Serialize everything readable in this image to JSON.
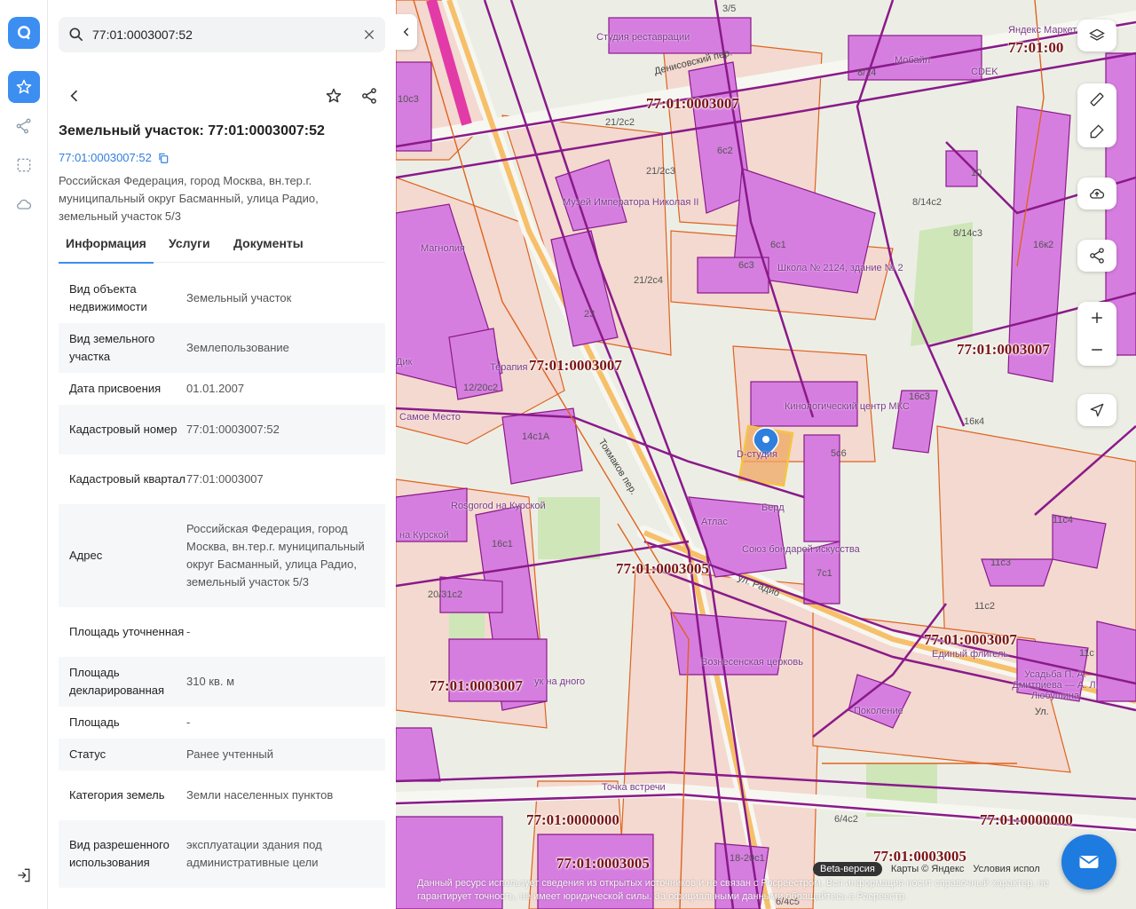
{
  "search": {
    "value": "77:01:0003007:52"
  },
  "object": {
    "title": "Земельный участок: 77:01:0003007:52",
    "cadastral_link": "77:01:0003007:52",
    "address": "Российская Федерация, город Москва, вн.тер.г. муниципальный округ Басманный, улица Радио, земельный участок 5/3"
  },
  "tabs": [
    {
      "label": "Информация",
      "active": true
    },
    {
      "label": "Услуги",
      "active": false
    },
    {
      "label": "Документы",
      "active": false
    }
  ],
  "info": [
    {
      "key": "Вид объекта недвижимости",
      "value": "Земельный участок"
    },
    {
      "key": "Вид земельного участка",
      "value": "Землепользование"
    },
    {
      "key": "Дата присвоения",
      "value": "01.01.2007"
    },
    {
      "key": "Кадастровый номер",
      "value": "77:01:0003007:52"
    },
    {
      "key": "Кадастровый квартал",
      "value": "77:01:0003007"
    },
    {
      "key": "Адрес",
      "value": "Российская Федерация, город Москва, вн.тер.г. муниципальный округ Басманный, улица Радио, земельный участок 5/3"
    },
    {
      "key": "Площадь уточненная",
      "value": "-"
    },
    {
      "key": "Площадь декларированная",
      "value": "310 кв. м"
    },
    {
      "key": "Площадь",
      "value": "-"
    },
    {
      "key": "Статус",
      "value": "Ранее учтенный"
    },
    {
      "key": "Категория земель",
      "value": "Земли населенных пунктов"
    },
    {
      "key": "Вид разрешенного использования",
      "value": "эксплуатации здания под административные цели"
    }
  ],
  "map": {
    "quarter_labels": [
      "77:01:0003007",
      "77:01:0003007",
      "77:01:0003007",
      "77:01:0003005",
      "77:01:0003007",
      "77:01:0003007",
      "77:01:0000000",
      "77:01:0000000",
      "77:01:0003005",
      "77:01:0003005",
      "77:01:00"
    ],
    "poi_labels": [
      "Студия реставрации",
      "Мобайл",
      "CDEK",
      "Яндекс Маркет",
      "Музей Императора Николая II",
      "Магнолия",
      "Школа № 2124, здание № 2",
      "Терапия",
      "Кинологический центр МКС",
      "D-студия",
      "Берд",
      "Атлас",
      "Союз бондарей искусства",
      "Rosgorod на Курской",
      "на Курской",
      "Вознесенская церковь",
      "Поколение",
      "Точка встречи",
      "Самое Место",
      "Дик",
      "Единый флигель",
      "Усадьба П. А. Дмитриева — А. Л. Любушина",
      "ук на дного"
    ],
    "building_labels": [
      "3/5",
      "8/14",
      "10с3",
      "6с2",
      "21/2с2",
      "21/2с3",
      "10",
      "8/14с2",
      "8/14с3",
      "16к2",
      "6с3",
      "6с1",
      "21/2с4",
      "23",
      "12/20с2",
      "14с1А",
      "16с3",
      "16к4",
      "5с6",
      "16с1",
      "11с4",
      "11с3",
      "11с2",
      "7с1",
      "20/31с2",
      "18-20с1",
      "6/4с2",
      "6/4с5",
      "11с"
    ],
    "street_labels": [
      "Денисовский пер.",
      "Токмаков пер.",
      "ул. Радио",
      "Ул."
    ],
    "attribution": {
      "beta": "Beta-версия",
      "maps": "Карты © Яндекс",
      "terms": "Условия испол"
    },
    "disclaimer": "Данный ресурс использует сведения из открытых источников и не связан с Росреестром. Вся информация носит справочный характер, не гарантирует точность, не имеет юридической силы. За официальными данными обращайтесь в Росреестр.",
    "colors": {
      "building": "#d67ee0",
      "parcel_border": "#e0621f",
      "quarter_border": "#8a1a8a",
      "selected": "#f5c542",
      "label": "#7a1414"
    }
  }
}
